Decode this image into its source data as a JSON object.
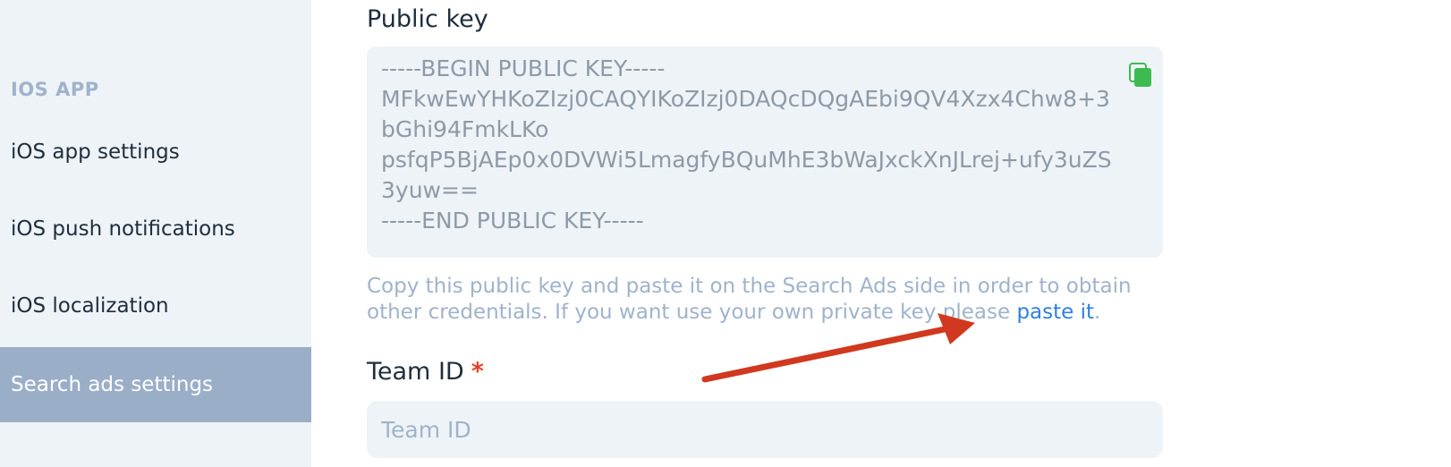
{
  "sidebar": {
    "section_title": "IOS APP",
    "items": [
      {
        "label": "iOS app settings",
        "active": false
      },
      {
        "label": "iOS push notifications",
        "active": false
      },
      {
        "label": "iOS localization",
        "active": false
      },
      {
        "label": "Search ads settings",
        "active": true
      }
    ]
  },
  "public_key": {
    "label": "Public key",
    "value": "-----BEGIN PUBLIC KEY-----\nMFkwEwYHKoZIzj0CAQYIKoZIzj0DAQcDQgAEbi9QV4Xzx4Chw8+3bGhi94FmkLKo\npsfqP5BjAEp0x0DVWi5LmagfyBQuMhE3bWaJxckXnJLrej+ufy3uZS3yuw==\n-----END PUBLIC KEY-----",
    "copy_icon": "copy-icon"
  },
  "help": {
    "text": "Copy this public key and paste it on the Search Ads side in order to obtain other credentials. If you want use your own private key please ",
    "link_label": "paste it",
    "suffix": "."
  },
  "team_id": {
    "label": "Team ID",
    "required_mark": "*",
    "value": "",
    "placeholder": "Team ID"
  },
  "colors": {
    "sidebar_bg": "#eef3f7",
    "active_item_bg": "#9aaec8",
    "link": "#2f7fe3",
    "required": "#e0432b",
    "annotation_arrow": "#d0391f",
    "copy_icon": "#3dbb4f"
  }
}
